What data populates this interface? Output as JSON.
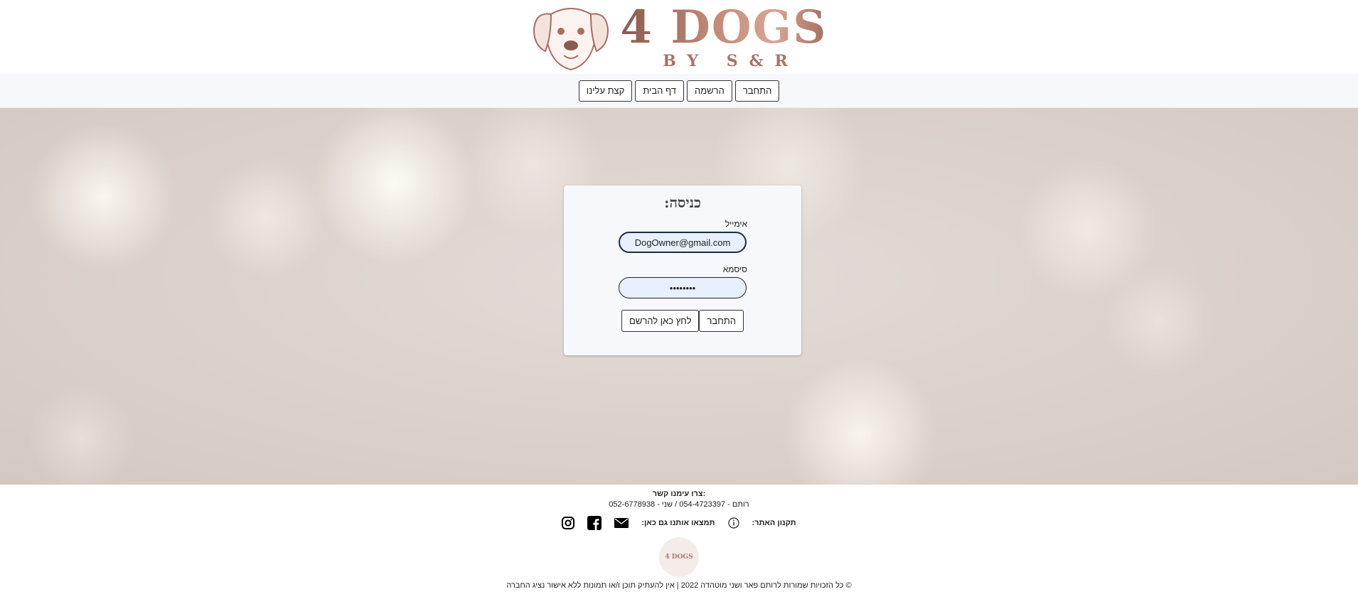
{
  "header": {
    "logo_main": "4 DOGS",
    "logo_sub": "BY S&R"
  },
  "nav": {
    "login": "התחבר",
    "register": "הרשמה",
    "home": "דף הבית",
    "about": "קצת עלינו"
  },
  "login_form": {
    "title": "כניסה:",
    "email_label": "אימייל",
    "email_value": "DogOwner@gmail.com",
    "password_label": "סיסמא",
    "password_value": "••••••••",
    "submit_label": "התחבר",
    "register_label": "לחץ כאן להרשם"
  },
  "footer": {
    "contact_title": "צרו עימנו קשר:",
    "contact_line": "רותם - 054-4723397 / שני - 052-6778938",
    "rules_label": "תקנון האתר:",
    "social_label": "תמצאו אותנו גם כאן:",
    "logo_text": "4 DOGS",
    "copyright": "© כל הזכויות שמורות לרותם פאר ושני מוטהדה 2022 | אין להעתיק תוכן ו/או תמונות ללא אישור נציג החברה"
  },
  "colors": {
    "brand": "#c88e7c",
    "brand_dark": "#8a5a50",
    "nav_bg": "#f7f8fb",
    "input_bg": "#e8f0fe"
  },
  "icons": [
    "dog-logo-icon",
    "info-icon",
    "mail-icon",
    "facebook-icon",
    "instagram-icon"
  ]
}
